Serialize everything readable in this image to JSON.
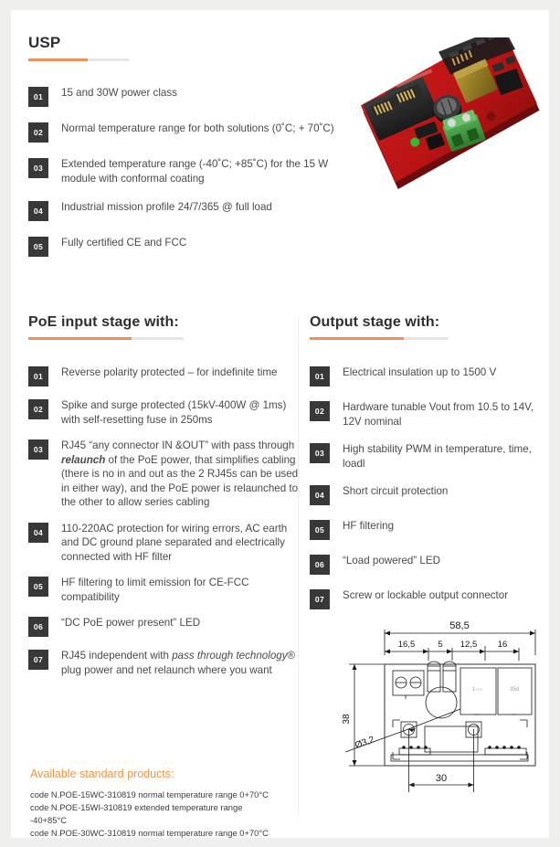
{
  "usp": {
    "title": "USP",
    "items": [
      {
        "num": "01",
        "text": "15 and 30W power class"
      },
      {
        "num": "02",
        "text": "Normal temperature range for both solutions (0˚C; + 70˚C)"
      },
      {
        "num": "03",
        "text": "Extended temperature range (-40˚C; +85˚C) for the 15 W module with conformal coating"
      },
      {
        "num": "04",
        "text": "Industrial mission profile 24/7/365 @ full load"
      },
      {
        "num": "05",
        "text": "Fully certified CE and FCC"
      }
    ]
  },
  "photo": {
    "alt_name": "poe-module-pcb-photo",
    "board_color": "#cc1515",
    "connector_color": "#3aa33a"
  },
  "poe_input": {
    "title": "PoE input stage with:",
    "items": [
      {
        "num": "01",
        "text": "Reverse polarity protected – for indefinite time"
      },
      {
        "num": "02",
        "text": "Spike and surge protected (15kV-400W @ 1ms) with self-resetting fuse in 250ms"
      },
      {
        "num": "03",
        "pre": "RJ45 “any connector IN &OUT” with pass through ",
        "emph": "relaunch",
        "post": " of the PoE power, that simplifies cabling (there is no in and out as the 2 RJ45s can be used in either way), and the PoE power is relaunched to the other to allow series cabling"
      },
      {
        "num": "04",
        "text": "110-220AC protection for wiring errors, AC earth and DC ground plane separated and electrically connected with HF filter"
      },
      {
        "num": "05",
        "text": "HF filtering to limit emission for CE-FCC compatibility"
      },
      {
        "num": "06",
        "text": "“DC PoE power present” LED"
      },
      {
        "num": "07",
        "pre": "RJ45 independent with ",
        "emph": "pass through technology",
        "post": "® plug power and net relaunch where you want"
      }
    ]
  },
  "output": {
    "title": "Output stage with:",
    "items": [
      {
        "num": "01",
        "text": "Electrical insulation up to 1500 V"
      },
      {
        "num": "02",
        "text": "Hardware tunable Vout from 10.5 to 14V, 12V nominal"
      },
      {
        "num": "03",
        "text": "High stability PWM in temperature, time, loadl"
      },
      {
        "num": "04",
        "text": "Short circuit protection"
      },
      {
        "num": "05",
        "text": "HF filtering"
      },
      {
        "num": "06",
        "text": "“Load powered” LED"
      },
      {
        "num": "07",
        "text": "Screw or lockable output connector"
      }
    ]
  },
  "drawing": {
    "name": "mechanical-dimension-drawing",
    "dims": {
      "overall_width": "58,5",
      "d1": "16,5",
      "d2": "5",
      "d3": "12,5",
      "d4": "16",
      "height": "38",
      "hole": "Ø3,2",
      "bottom": "30"
    },
    "component_labels": {
      "left": "1∩∩",
      "right": "35d"
    }
  },
  "products": {
    "title": "Available standard products:",
    "lines": [
      "code N.POE-15WC-310819 normal temperature range 0+70°C",
      "code N.POE-15WI-310819 extended temperature range",
      "-40+85°C",
      "code N.POE-30WC-310819 normal temperature range 0+70°C"
    ]
  },
  "colors": {
    "accent_orange": "#f0905c",
    "product_orange": "#f4933f",
    "badge_dark": "#383838",
    "body_text": "#4a4a4a",
    "page_bg": "#efefed"
  }
}
